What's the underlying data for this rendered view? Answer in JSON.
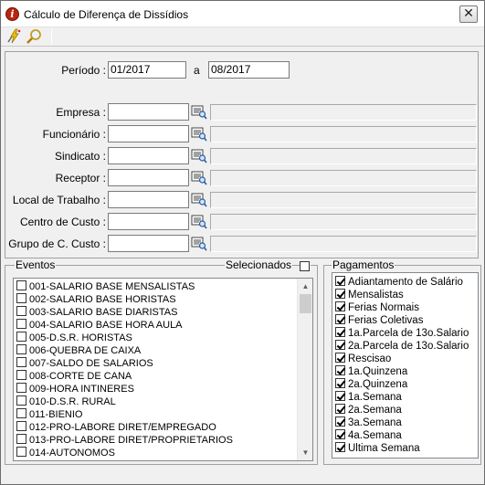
{
  "window": {
    "title": "Cálculo de Diferença de Dissídios",
    "close_glyph": "✕"
  },
  "toolbar": {
    "execute_icon": "lightning-run-icon",
    "search_icon": "magnifier-icon"
  },
  "period": {
    "label": "Período :",
    "from": "01/2017",
    "separator": "a",
    "to": "08/2017"
  },
  "filters": [
    {
      "label": "Empresa :",
      "value": ""
    },
    {
      "label": "Funcionário :",
      "value": ""
    },
    {
      "label": "Sindicato :",
      "value": ""
    },
    {
      "label": "Receptor :",
      "value": ""
    },
    {
      "label": "Local de Trabalho :",
      "value": ""
    },
    {
      "label": "Centro de Custo :",
      "value": ""
    },
    {
      "label": "Grupo de C. Custo :",
      "value": ""
    }
  ],
  "eventos": {
    "title": "Eventos",
    "selected_label": "Selecionados",
    "selected_checked": false,
    "items": [
      "001-SALARIO BASE MENSALISTAS",
      "002-SALARIO BASE HORISTAS",
      "003-SALARIO BASE DIARISTAS",
      "004-SALARIO BASE HORA AULA",
      "005-D.S.R. HORISTAS",
      "006-QUEBRA DE CAIXA",
      "007-SALDO DE SALARIOS",
      "008-CORTE DE CANA",
      "009-HORA INTINERES",
      "010-D.S.R. RURAL",
      "011-BIENIO",
      "012-PRO-LABORE DIRET/EMPREGADO",
      "013-PRO-LABORE DIRET/PROPRIETARIOS",
      "014-AUTONOMOS"
    ]
  },
  "pagamentos": {
    "title": "Pagamentos",
    "items": [
      "Adiantamento de Salário",
      "Mensalistas",
      "Ferias Normais",
      "Ferias Coletivas",
      "1a.Parcela de 13o.Salario",
      "2a.Parcela de 13o.Salario",
      "Rescisao",
      "1a.Quinzena",
      "2a.Quinzena",
      "1a.Semana",
      "2a.Semana",
      "3a.Semana",
      "4a.Semana",
      "Ultima Semana"
    ]
  }
}
